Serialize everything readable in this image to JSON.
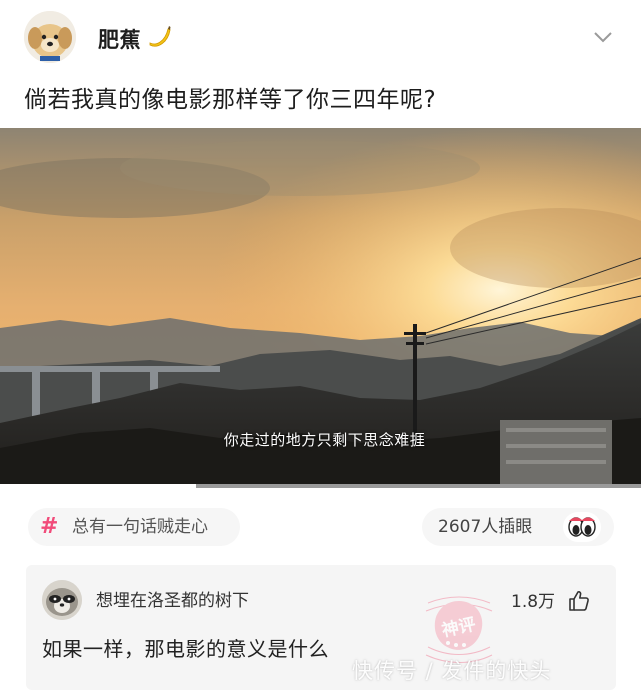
{
  "post": {
    "username": "肥蕉",
    "text": "倘若我真的像电影那样等了你三四年呢?",
    "video_subtitle": "你走过的地方只剩下思念难捱"
  },
  "topic": {
    "icon": "hash-icon",
    "label": "总有一句话贼走心"
  },
  "reaction": {
    "count": "2607人插眼",
    "icon": "eyes-icon"
  },
  "comment": {
    "author": "想埋在洛圣都的树下",
    "likes": "1.8万",
    "text": "如果一样，那电影的意义是什么",
    "stamp_text": "神评"
  },
  "watermark": "快传号 / 发件的快头",
  "colors": {
    "accent": "#f14b7a",
    "chip_bg": "#f6f6f6",
    "comment_bg": "#f5f5f5"
  }
}
